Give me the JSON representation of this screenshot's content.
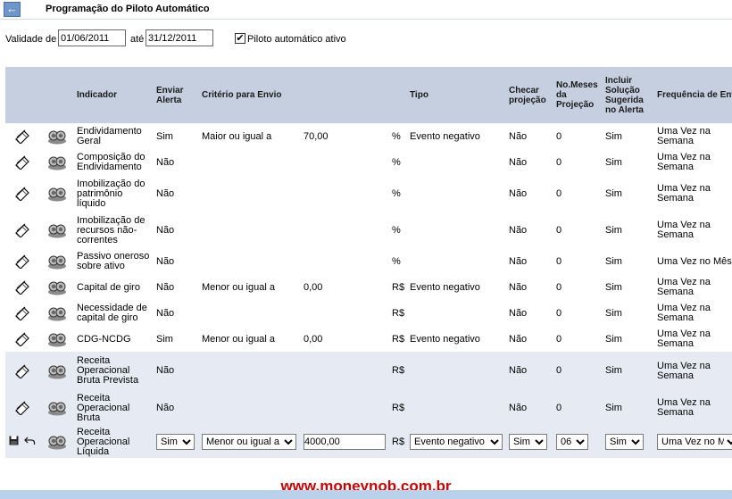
{
  "header": {
    "title": "Programação do Piloto Automático",
    "back_icon": "back-arrow-icon"
  },
  "validity": {
    "label_from": "Validade de",
    "from": "01/06/2011",
    "label_to": "até",
    "to": "31/12/2011",
    "checkbox_checked": true,
    "checkbox_label": "Piloto automático ativo"
  },
  "table": {
    "columns": [
      "",
      "",
      "Indicador",
      "Enviar Alerta",
      "Critério para Envio",
      "",
      "",
      "Tipo",
      "Checar projeção",
      "No.Meses da Projeção",
      "Incluir Solução Sugerida no Alerta",
      "Frequência de Envio"
    ],
    "rows": [
      {
        "indicador": "Endividamento Geral",
        "enviar": "Sim",
        "criterio": "Maior ou igual a",
        "valor": "70,00",
        "unidade": "%",
        "tipo": "Evento negativo",
        "checar": "Não",
        "meses": "0",
        "incluir": "Sim",
        "frequencia": "Uma Vez na Semana"
      },
      {
        "indicador": "Composição do Endividamento",
        "enviar": "Não",
        "criterio": "",
        "valor": "",
        "unidade": "%",
        "tipo": "",
        "checar": "Não",
        "meses": "0",
        "incluir": "Sim",
        "frequencia": "Uma Vez na Semana"
      },
      {
        "indicador": "Imobilização do patrimônio líquido",
        "enviar": "Não",
        "criterio": "",
        "valor": "",
        "unidade": "%",
        "tipo": "",
        "checar": "Não",
        "meses": "0",
        "incluir": "Sim",
        "frequencia": "Uma Vez na Semana"
      },
      {
        "indicador": "Imobilização de recursos não-correntes",
        "enviar": "Não",
        "criterio": "",
        "valor": "",
        "unidade": "%",
        "tipo": "",
        "checar": "Não",
        "meses": "0",
        "incluir": "Sim",
        "frequencia": "Uma Vez na Semana"
      },
      {
        "indicador": "Passivo oneroso sobre ativo",
        "enviar": "Não",
        "criterio": "",
        "valor": "",
        "unidade": "%",
        "tipo": "",
        "checar": "Não",
        "meses": "0",
        "incluir": "Sim",
        "frequencia": "Uma Vez no Mês"
      },
      {
        "indicador": "Capital de giro",
        "enviar": "Não",
        "criterio": "Menor ou igual a",
        "valor": "0,00",
        "unidade": "R$",
        "tipo": "Evento negativo",
        "checar": "Não",
        "meses": "0",
        "incluir": "Sim",
        "frequencia": "Uma Vez na Semana"
      },
      {
        "indicador": "Necessidade de capital de giro",
        "enviar": "Não",
        "criterio": "",
        "valor": "",
        "unidade": "R$",
        "tipo": "",
        "checar": "Não",
        "meses": "0",
        "incluir": "Sim",
        "frequencia": "Uma Vez na Semana"
      },
      {
        "indicador": "CDG-NCDG",
        "enviar": "Sim",
        "criterio": "Menor ou igual a",
        "valor": "0,00",
        "unidade": "R$",
        "tipo": "Evento negativo",
        "checar": "Não",
        "meses": "0",
        "incluir": "Sim",
        "frequencia": "Uma Vez na Semana"
      },
      {
        "indicador": "Receita Operacional Bruta Prevista",
        "enviar": "Não",
        "criterio": "",
        "valor": "",
        "unidade": "R$",
        "tipo": "",
        "checar": "Não",
        "meses": "0",
        "incluir": "Sim",
        "frequencia": "Uma Vez na Semana"
      },
      {
        "indicador": "Receita Operacional Bruta",
        "enviar": "Não",
        "criterio": "",
        "valor": "",
        "unidade": "R$",
        "tipo": "",
        "checar": "Não",
        "meses": "0",
        "incluir": "Sim",
        "frequencia": "Uma Vez na Semana"
      }
    ],
    "edit_row": {
      "indicador": "Receita Operacional Líquida",
      "enviar": "Sim",
      "criterio": "Menor ou igual a",
      "valor": "4000,00",
      "unidade": "R$",
      "tipo": "Evento negativo",
      "checar": "Sim",
      "meses": "06",
      "incluir": "Sim",
      "frequencia": "Uma Vez no Mês"
    }
  },
  "footer": {
    "site": "www.moneynob.com.br"
  }
}
